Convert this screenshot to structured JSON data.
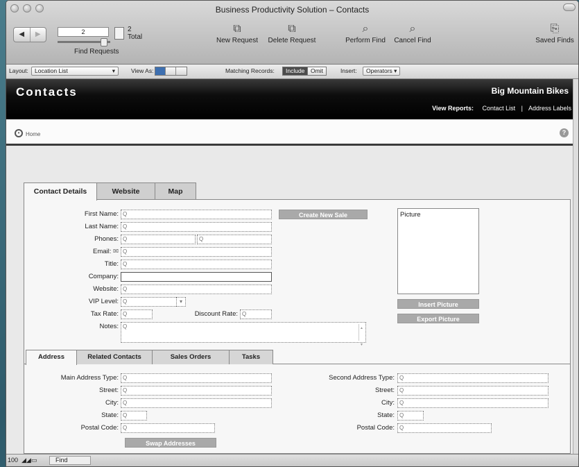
{
  "window": {
    "title": "Business Productivity Solution – Contacts"
  },
  "toolbar": {
    "record_field": "2",
    "record_count": "2",
    "record_total_label": "Total",
    "find_requests_label": "Find Requests",
    "new_request": "New Request",
    "delete_request": "Delete Request",
    "perform_find": "Perform Find",
    "cancel_find": "Cancel Find",
    "saved_finds": "Saved Finds"
  },
  "layoutbar": {
    "layout_label": "Layout:",
    "layout_value": "Location List",
    "view_as_label": "View As:",
    "matching_label": "Matching Records:",
    "include": "Include",
    "omit": "Omit",
    "insert_label": "Insert:",
    "operators": "Operators"
  },
  "header": {
    "title": "Contacts",
    "company": "Big Mountain Bikes",
    "view_reports": "View Reports:",
    "contact_list": "Contact List",
    "separator": "|",
    "address_labels": "Address Labels"
  },
  "breadcrumb": {
    "home": "Home",
    "help": "?"
  },
  "tabs": [
    "Contact Details",
    "Website",
    "Map"
  ],
  "contact": {
    "first_name": "First Name:",
    "last_name": "Last Name:",
    "phones": "Phones:",
    "email": "Email:",
    "title": "Title:",
    "company": "Company:",
    "website": "Website:",
    "vip_level": "VIP Level:",
    "tax_rate": "Tax Rate:",
    "discount_rate": "Discount Rate:",
    "notes": "Notes:",
    "create_new_sale": "Create New Sale",
    "picture": "Picture",
    "insert_picture": "Insert Picture",
    "export_picture": "Export Picture",
    "search_glyph": "Q"
  },
  "subtabs": [
    "Address",
    "Related Contacts",
    "Sales Orders",
    "Tasks"
  ],
  "address": {
    "main_type": "Main Address Type:",
    "street": "Street:",
    "city": "City:",
    "state": "State:",
    "postal": "Postal Code:",
    "second_type": "Second Address Type:",
    "swap": "Swap Addresses"
  },
  "status": {
    "zoom": "100",
    "mode": "Find"
  }
}
